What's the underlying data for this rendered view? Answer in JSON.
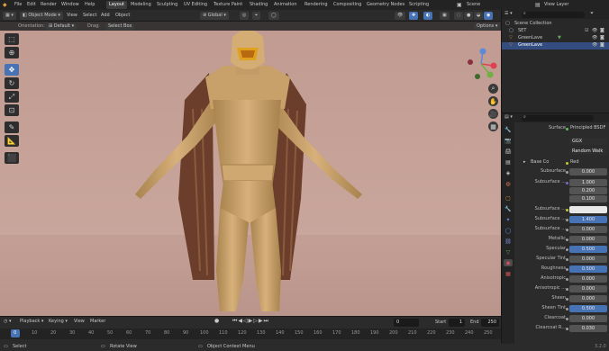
{
  "menu": [
    "File",
    "Edit",
    "Render",
    "Window",
    "Help"
  ],
  "workspace_tabs": [
    "Layout",
    "Modeling",
    "Sculpting",
    "UV Editing",
    "Texture Paint",
    "Shading",
    "Animation",
    "Rendering",
    "Compositing",
    "Geometry Nodes",
    "Scripting"
  ],
  "workspace_active": "Layout",
  "scene": "Scene",
  "view_layer": "View Layer",
  "viewport": {
    "mode": "Object Mode",
    "menus": [
      "View",
      "Select",
      "Add",
      "Object"
    ],
    "transform": "Global",
    "orientation_label": "Orientation:",
    "orientation_value": "Default",
    "drag_label": "Drag:",
    "drag_value": "Select Box",
    "options": "Options"
  },
  "outliner": {
    "rows": [
      {
        "name": "Scene Collection",
        "selected": false
      },
      {
        "name": "SET",
        "selected": false
      },
      {
        "name": "GreenLave",
        "selected": false
      },
      {
        "name": "GreenLave",
        "selected": true
      }
    ]
  },
  "properties": {
    "surface_label": "Surface",
    "surface_value": "Principled BSDF",
    "distribution": "GGX",
    "subsurface_method": "Random Walk",
    "base_color_label": "Base Co",
    "base_color_value": "Red",
    "rows": [
      {
        "label": "Subsurface",
        "value": "0.000",
        "blue": false
      },
      {
        "label": "Subsurface ...",
        "value": "1.000",
        "blue": false
      },
      {
        "label": "",
        "value": "0.200",
        "blue": false
      },
      {
        "label": "",
        "value": "0.100",
        "blue": false
      },
      {
        "label": "Subsurface ...",
        "value": "",
        "blue": false
      },
      {
        "label": "Subsurface ...",
        "value": "1.400",
        "blue": true
      },
      {
        "label": "Subsurface ...",
        "value": "0.000",
        "blue": false
      },
      {
        "label": "Metallic",
        "value": "0.000",
        "blue": false
      },
      {
        "label": "Specular",
        "value": "0.500",
        "blue": true
      },
      {
        "label": "Specular Tint",
        "value": "0.000",
        "blue": false
      },
      {
        "label": "Roughness",
        "value": "0.500",
        "blue": true
      },
      {
        "label": "Anisotropic",
        "value": "0.000",
        "blue": false
      },
      {
        "label": "Anisotropic ...",
        "value": "0.000",
        "blue": false
      },
      {
        "label": "Sheen",
        "value": "0.000",
        "blue": false
      },
      {
        "label": "Sheen Tint",
        "value": "0.500",
        "blue": true
      },
      {
        "label": "Clearcoat",
        "value": "0.000",
        "blue": false
      },
      {
        "label": "Clearcoat R...",
        "value": "0.030",
        "blue": false
      }
    ]
  },
  "timeline": {
    "menus": [
      "Playback",
      "Keying",
      "View",
      "Marker"
    ],
    "current_frame": "0",
    "start_label": "Start",
    "start_value": "1",
    "end_label": "End",
    "end_value": "250",
    "ticks": [
      "0",
      "10",
      "20",
      "30",
      "40",
      "50",
      "60",
      "70",
      "80",
      "90",
      "100",
      "110",
      "120",
      "130",
      "140",
      "150",
      "160",
      "170",
      "180",
      "190",
      "200",
      "210",
      "220",
      "230",
      "240",
      "250"
    ]
  },
  "status": {
    "select": "Select",
    "rotate": "Rotate View",
    "context": "Object Context Menu",
    "version": "3.2.0"
  }
}
